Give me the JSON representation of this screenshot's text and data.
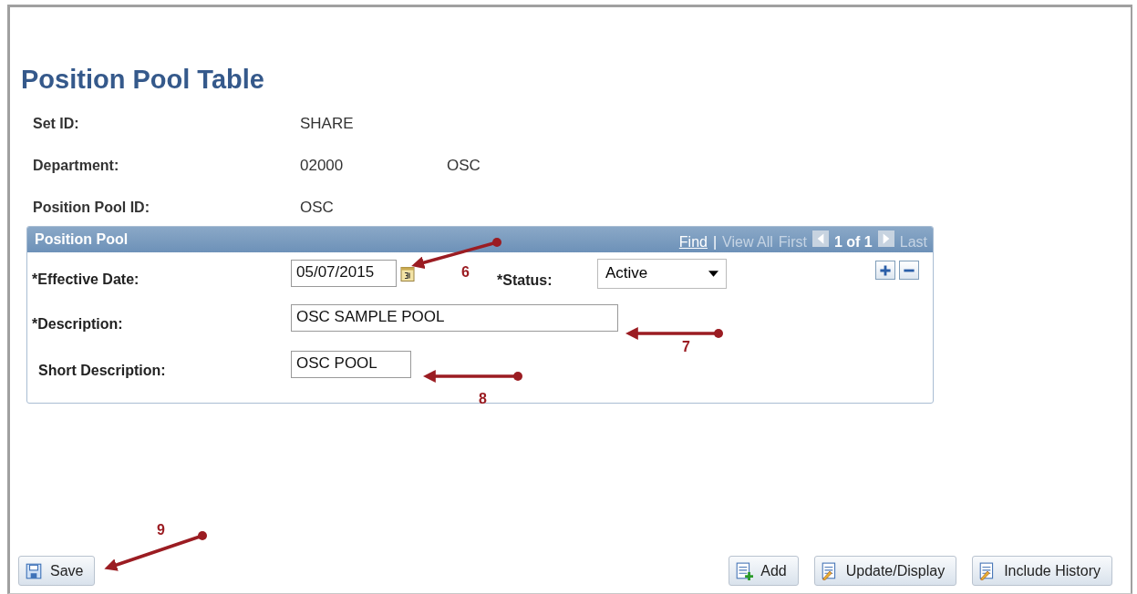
{
  "page_title": "Position Pool Table",
  "key_fields": [
    {
      "label": "Set ID:",
      "values": [
        "SHARE"
      ]
    },
    {
      "label": "Department:",
      "values": [
        "02000",
        "OSC"
      ]
    },
    {
      "label": "Position Pool ID:",
      "values": [
        "OSC"
      ]
    }
  ],
  "section": {
    "title": "Position Pool",
    "nav": {
      "find": "Find",
      "separator": "|",
      "view_all": "View All",
      "first": "First",
      "count": "1 of 1",
      "last": "Last"
    },
    "effective_date": {
      "label": "*Effective Date:",
      "value": "05/07/2015"
    },
    "status": {
      "label": "*Status:",
      "value": "Active"
    },
    "description": {
      "label": "*Description:",
      "value": "OSC SAMPLE POOL"
    },
    "short_description": {
      "label": "Short Description:",
      "value": "OSC POOL"
    }
  },
  "callouts": [
    {
      "number": "6"
    },
    {
      "number": "7"
    },
    {
      "number": "8"
    },
    {
      "number": "9"
    }
  ],
  "buttons": [
    {
      "kind": "save",
      "label": "Save"
    },
    {
      "kind": "add",
      "label": "Add"
    },
    {
      "kind": "update",
      "label": "Update/Display"
    },
    {
      "kind": "history",
      "label": "Include History"
    }
  ]
}
